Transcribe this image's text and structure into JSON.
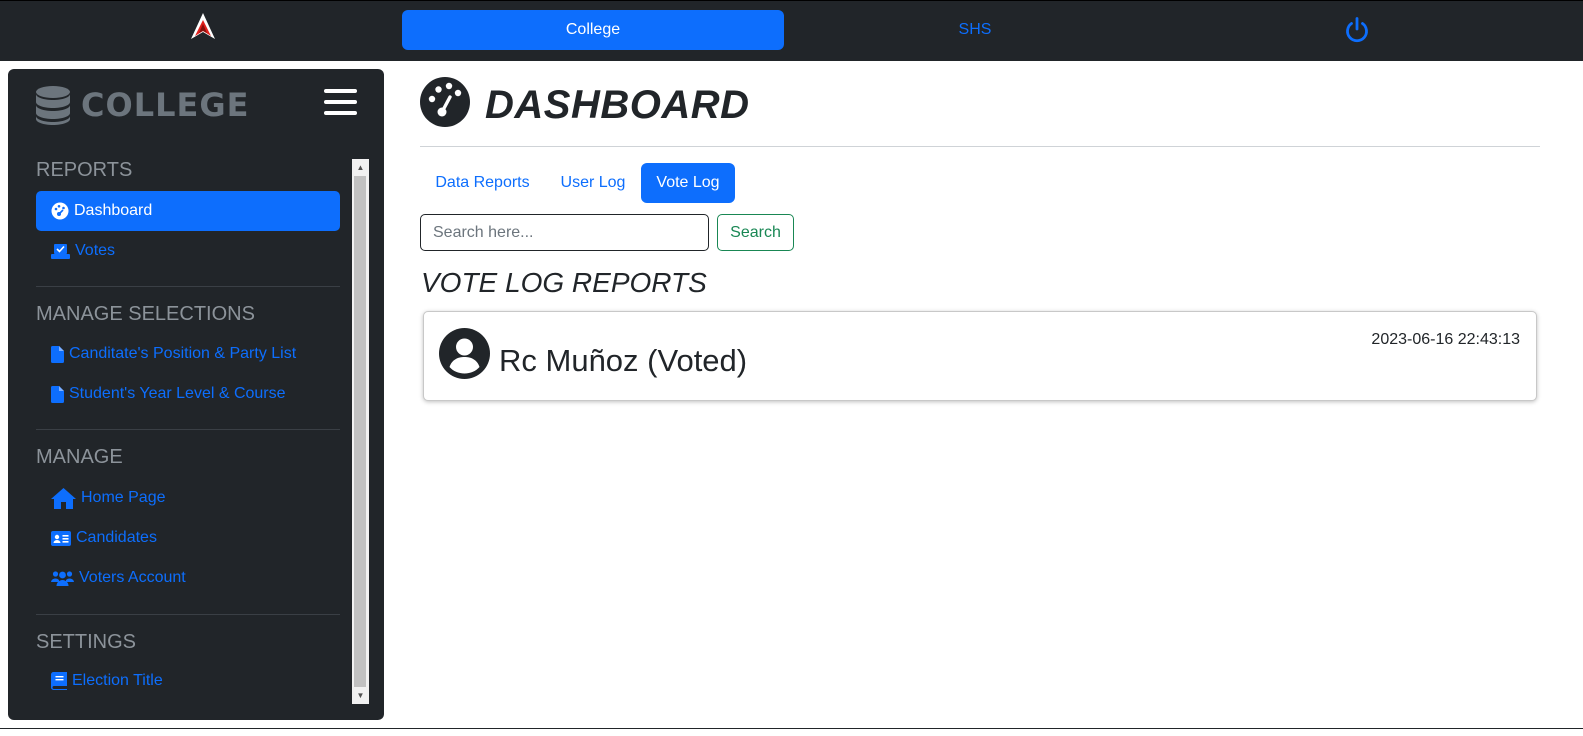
{
  "topnav": {
    "college_label": "College",
    "shs_label": "SHS"
  },
  "sidebar": {
    "brand": "COLLEGE",
    "sections": {
      "reports": "REPORTS",
      "manage_selections": "MANAGE SELECTIONS",
      "manage": "MANAGE",
      "settings": "SETTINGS"
    },
    "items": {
      "dashboard": "Dashboard",
      "votes": "Votes",
      "positions": "Canditate's Position & Party List",
      "year_level": "Student's Year Level & Course",
      "home_page": "Home Page",
      "candidates": "Candidates",
      "voters_account": "Voters Account",
      "election_title": "Election Title"
    }
  },
  "main": {
    "title": "DASHBOARD",
    "tabs": [
      "Data Reports",
      "User Log",
      "Vote Log"
    ],
    "active_tab": "Vote Log",
    "search": {
      "placeholder": "Search here...",
      "button": "Search"
    },
    "reports_title": "VOTE LOG REPORTS",
    "logs": [
      {
        "name": "Rc Muñoz (Voted)",
        "timestamp": "2023-06-16 22:43:13"
      }
    ]
  },
  "colors": {
    "primary": "#0d6efd",
    "dark": "#212529",
    "muted": "#6c757d",
    "success": "#198754"
  }
}
